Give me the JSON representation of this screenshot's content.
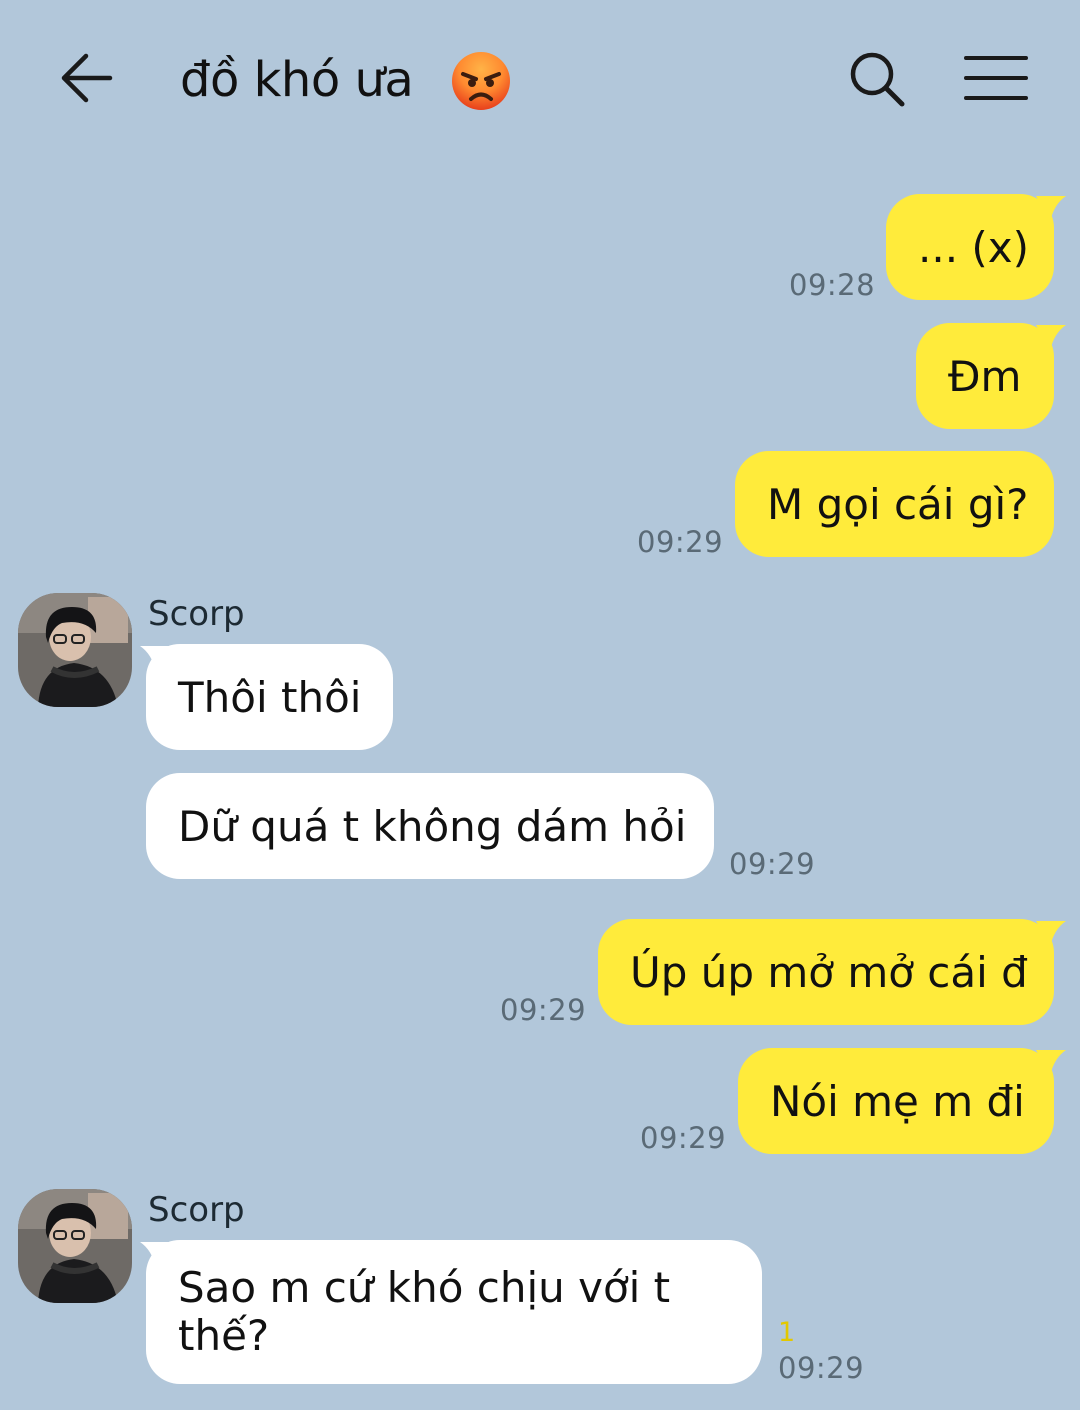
{
  "header": {
    "title": "đồ khó ưa",
    "title_emoji": "angry-face"
  },
  "colors": {
    "background": "#b2c7da",
    "my_bubble": "#ffeb3b",
    "their_bubble": "#ffffff",
    "unread": "#e3c800"
  },
  "messages": [
    {
      "from": "me",
      "text": "... (x)",
      "time": "09:28"
    },
    {
      "from": "me",
      "text": "Đm",
      "time": ""
    },
    {
      "from": "me",
      "text": "M gọi cái gì?",
      "time": "09:29"
    },
    {
      "from": "them",
      "sender": "Scorp",
      "text": "Thôi thôi",
      "time": ""
    },
    {
      "from": "them",
      "text": "Dữ quá t không dám hỏi",
      "time": "09:29"
    },
    {
      "from": "me",
      "text": "Úp úp mở mở cái đ",
      "time": "09:29"
    },
    {
      "from": "me",
      "text": "Nói mẹ m đi",
      "time": "09:29"
    },
    {
      "from": "them",
      "sender": "Scorp",
      "text_line1": "Sao m cứ khó chịu với t",
      "text_line2": "thế?",
      "time": "09:29",
      "unread": "1"
    }
  ]
}
